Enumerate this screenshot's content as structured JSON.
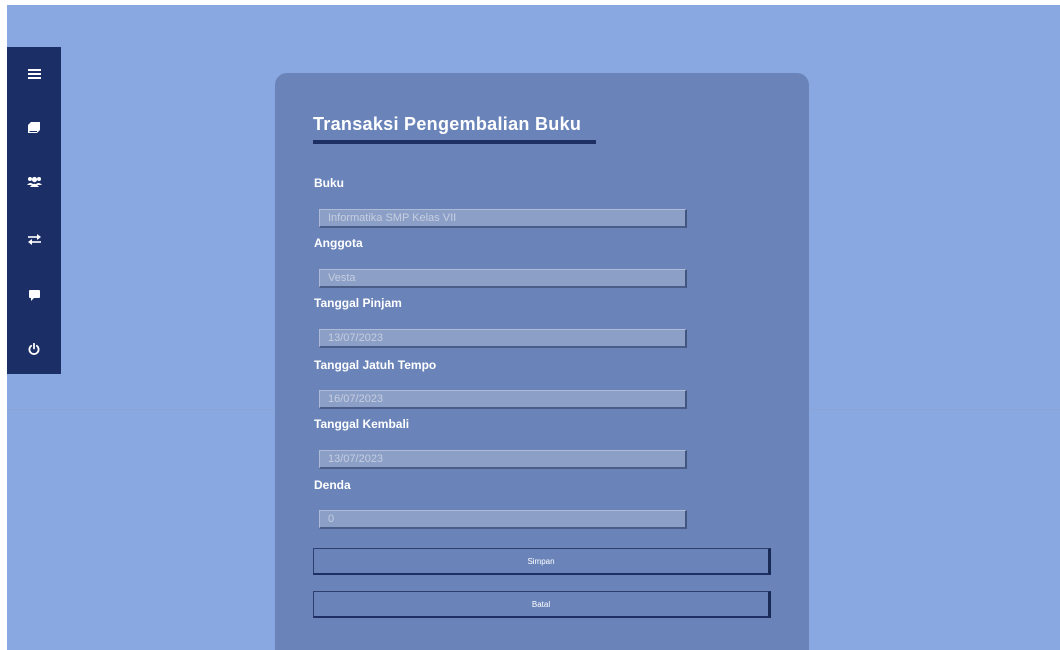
{
  "sidebar": {
    "items": [
      {
        "icon": "menu-icon"
      },
      {
        "icon": "book-icon"
      },
      {
        "icon": "users-icon"
      },
      {
        "icon": "exchange-icon"
      },
      {
        "icon": "comment-icon"
      },
      {
        "icon": "power-icon"
      }
    ]
  },
  "form": {
    "title": "Transaksi Pengembalian Buku",
    "fields": [
      {
        "label": "Buku",
        "value": "Informatika SMP Kelas VII"
      },
      {
        "label": "Anggota",
        "value": "Vesta"
      },
      {
        "label": "Tanggal Pinjam",
        "value": "13/07/2023"
      },
      {
        "label": "Tanggal Jatuh Tempo",
        "value": "16/07/2023"
      },
      {
        "label": "Tanggal Kembali",
        "value": "13/07/2023"
      },
      {
        "label": "Denda",
        "value": "0"
      }
    ],
    "save_label": "Simpan",
    "cancel_label": "Batal"
  },
  "colors": {
    "background": "#89a8e2",
    "sidebar": "#1b2e66",
    "card": "#6a84b9",
    "accent": "#1e2f63"
  }
}
